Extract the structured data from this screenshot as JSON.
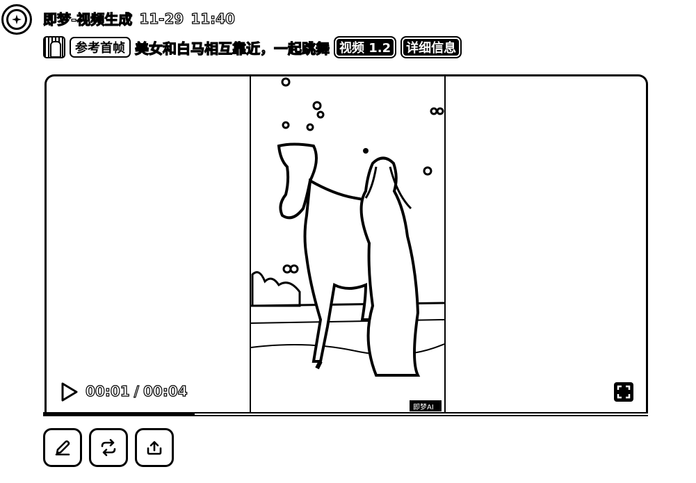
{
  "header": {
    "app_name": "即梦-视频生成",
    "date": "11-29",
    "time": "11:40"
  },
  "prompt": {
    "reference_label": "参考首帧",
    "text": "美女和白马相互靠近，一起跳舞",
    "model_chip": "视频 1.2",
    "details_chip": "详细信息"
  },
  "player": {
    "current_time": "00:01",
    "separator": "/",
    "duration": "00:04",
    "progress": 0.25,
    "watermark": "即梦AI"
  },
  "icons": {
    "logo": "jimeng-logo-icon",
    "play": "play-icon",
    "fullscreen": "fullscreen-icon",
    "edit": "edit-pencil-icon",
    "regenerate": "regenerate-icon",
    "upload": "upload-icon"
  },
  "colors": {
    "foreground": "#000000",
    "background": "#ffffff"
  }
}
